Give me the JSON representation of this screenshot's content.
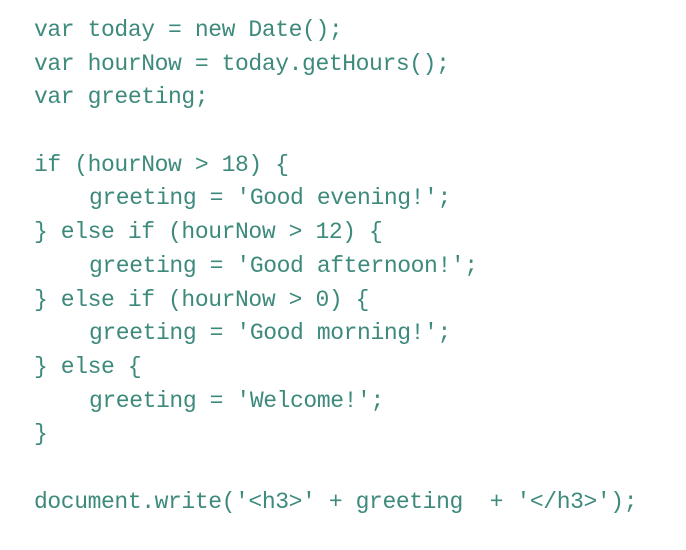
{
  "code": {
    "lines": [
      "var today = new Date();",
      "var hourNow = today.getHours();",
      "var greeting;",
      "",
      "if (hourNow > 18) {",
      "greeting = 'Good evening!';",
      "} else if (hourNow > 12) {",
      "greeting = 'Good afternoon!';",
      "} else if (hourNow > 0) {",
      "greeting = 'Good morning!';",
      "} else {",
      "greeting = 'Welcome!';",
      "}",
      "",
      "document.write('<h3>' + greeting  + '</h3>');"
    ]
  }
}
